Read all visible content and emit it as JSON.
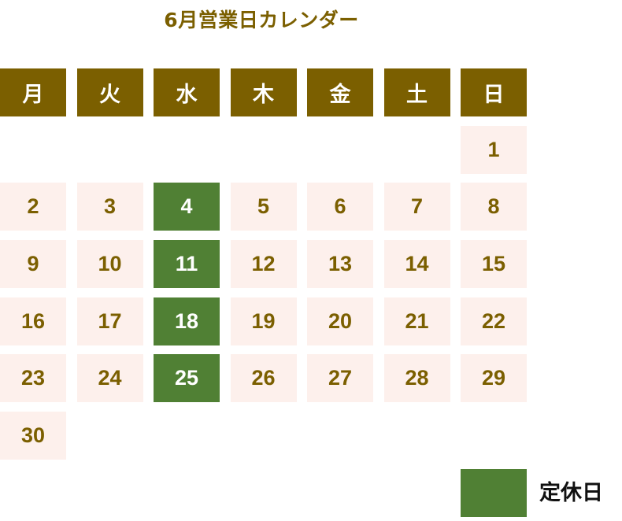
{
  "title": "6月営業日カレンダー",
  "weekdays": [
    "月",
    "火",
    "水",
    "木",
    "金",
    "土",
    "日"
  ],
  "days": [
    "",
    "",
    "",
    "",
    "",
    "",
    "1",
    "2",
    "3",
    "4",
    "5",
    "6",
    "7",
    "8",
    "9",
    "10",
    "11",
    "12",
    "13",
    "14",
    "15",
    "16",
    "17",
    "18",
    "19",
    "20",
    "21",
    "22",
    "23",
    "24",
    "25",
    "26",
    "27",
    "28",
    "29",
    "30",
    "",
    "",
    "",
    "",
    "",
    ""
  ],
  "holidays": [
    "4",
    "11",
    "18",
    "25"
  ],
  "legend": {
    "label": "定休日"
  },
  "colors": {
    "header": "#7b5f00",
    "holiday": "#508034",
    "day_bg": "#fdf0ec",
    "day_text": "#7b5f00"
  }
}
